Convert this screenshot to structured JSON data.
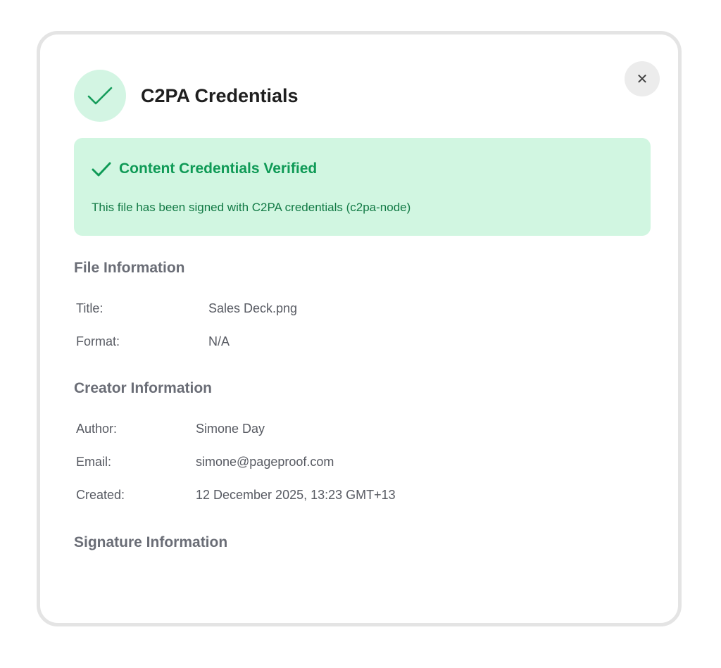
{
  "header": {
    "title": "C2PA Credentials",
    "icon": "check-icon",
    "close_glyph": "✕",
    "accent_color": "#0f9a56"
  },
  "verified": {
    "title": "Content Credentials Verified",
    "description": "This file has been signed with C2PA credentials (c2pa-node)"
  },
  "file_info": {
    "heading": "File Information",
    "rows": [
      {
        "label": "Title:",
        "value": "Sales Deck.png"
      },
      {
        "label": "Format:",
        "value": "N/A"
      }
    ]
  },
  "creator_info": {
    "heading": "Creator Information",
    "rows": [
      {
        "label": "Author:",
        "value": "Simone Day"
      },
      {
        "label": "Email:",
        "value": "simone@pageproof.com"
      },
      {
        "label": "Created:",
        "value": "12 December 2025, 13:23 GMT+13"
      }
    ]
  },
  "signature_info": {
    "heading": "Signature Information"
  }
}
